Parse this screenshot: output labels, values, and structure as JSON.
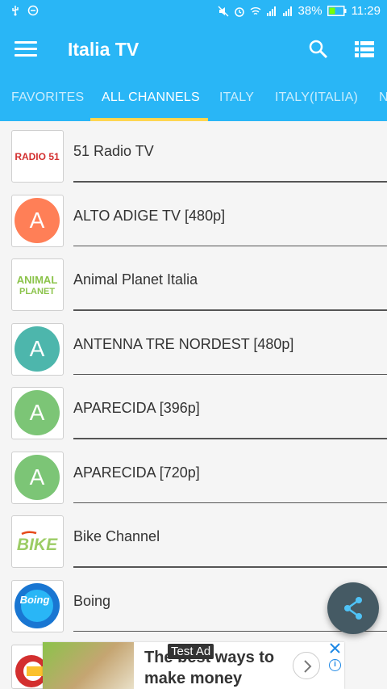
{
  "status_bar": {
    "battery": "38%",
    "time": "11:29"
  },
  "app_bar": {
    "title": "Italia TV"
  },
  "tabs": [
    {
      "label": "FAVORITES"
    },
    {
      "label": "ALL CHANNELS",
      "selected": true
    },
    {
      "label": "ITALY"
    },
    {
      "label": "ITALY(ITALIA)"
    },
    {
      "label": "N"
    }
  ],
  "channels": [
    {
      "name": "51 Radio TV",
      "logo_text": "RADIO 51",
      "logo_color": "#d32f2f"
    },
    {
      "name": "ALTO ADIGE TV [480p]",
      "avatar_letter": "A",
      "avatar_color": "#ff7f57"
    },
    {
      "name": "Animal Planet Italia",
      "logo_line1": "ANIMAL",
      "logo_line2": "PLANET",
      "logo_color": "#8bc34a"
    },
    {
      "name": "ANTENNA TRE NORDEST [480p]",
      "avatar_letter": "A",
      "avatar_color": "#4db6ac"
    },
    {
      "name": "APARECIDA [396p]",
      "avatar_letter": "A",
      "avatar_color": "#7cc576"
    },
    {
      "name": "APARECIDA [720p]",
      "avatar_letter": "A",
      "avatar_color": "#7cc576"
    },
    {
      "name": "Bike Channel",
      "logo_text": "BIKE",
      "logo_color": "#9ccc65"
    },
    {
      "name": "Boing",
      "logo_text": "Boing",
      "logo_color": "#1976d2"
    }
  ],
  "ad": {
    "headline": "The best ways to make money",
    "badge": "Test Ad"
  },
  "theme": {
    "primary": "#29b6f6",
    "indicator": "#ffd54f",
    "fab": "#455a64"
  }
}
